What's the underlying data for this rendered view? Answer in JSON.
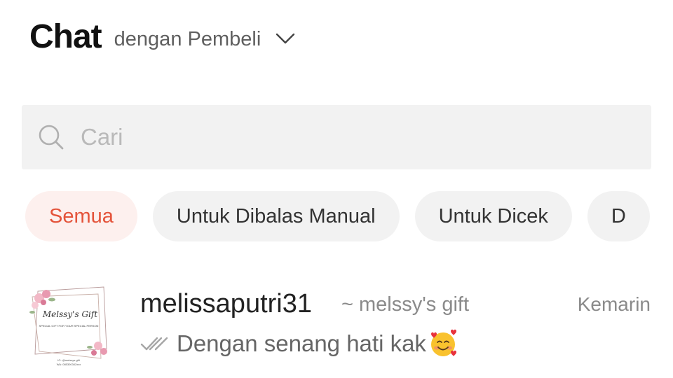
{
  "header": {
    "title": "Chat",
    "subtitle": "dengan Pembeli",
    "dropdown_icon": "chevron-down-icon"
  },
  "search": {
    "placeholder": "Cari",
    "value": "",
    "icon": "search-icon"
  },
  "filters": [
    {
      "label": "Semua",
      "active": true
    },
    {
      "label": "Untuk Dibalas Manual",
      "active": false
    },
    {
      "label": "Untuk Dicek",
      "active": false
    },
    {
      "label": "D",
      "active": false
    }
  ],
  "chats": [
    {
      "username": "melissaputri31",
      "shop": "~ melssy's gift",
      "time": "Kemarin",
      "preview": "Dengan senang hati kak",
      "status_icon": "double-check-icon",
      "emoji": "smiling-face-with-hearts-icon",
      "avatar": {
        "brand": "Melssy's Gift",
        "tagline": "SPECIAL GIFT FOR YOUR SPECIAL PERSON",
        "contact": "IG: @melssys.gift",
        "phone": "WA: 085300342xxx"
      }
    }
  ],
  "colors": {
    "accent": "#e4533a",
    "accent_bg": "#fdf0ee",
    "chip_bg": "#f2f2f2",
    "search_bg": "#f2f2f2"
  }
}
